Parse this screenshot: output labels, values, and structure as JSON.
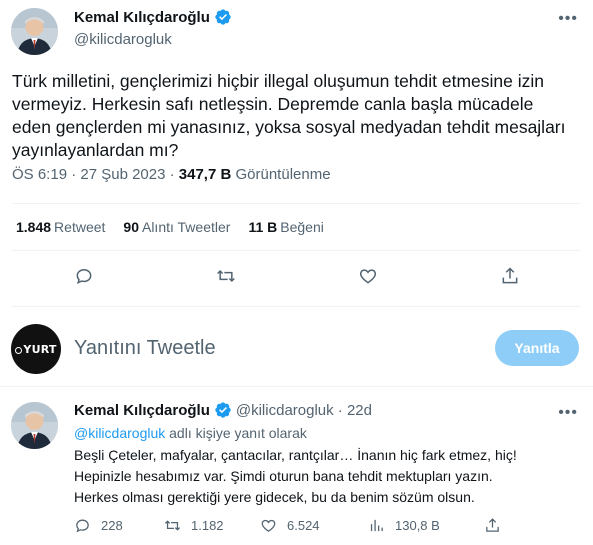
{
  "main": {
    "display_name": "Kemal Kılıçdaroğlu",
    "handle": "@kilicdarogluk",
    "text": "Türk milletini, gençlerimizi hiçbir illegal oluşumun tehdit etmesine izin vermeyiz. Herkesin safı netleşsin. Depremde canla başla mücadele eden gençlerden mi yanasınız, yoksa sosyal medyadan tehdit mesajları yayınlayanlardan mı?",
    "time": "ÖS 6:19 · 27 Şub 2023 · ",
    "views": "347,7 B",
    "views_label": " Görüntülenme",
    "stats": {
      "retweets": "1.848",
      "retweets_label": "Retweet",
      "quotes": "90",
      "quotes_label": "Alıntı Tweetler",
      "likes": "11 B",
      "likes_label": "Beğeni"
    }
  },
  "reply_box": {
    "avatar_text": "YURT",
    "prompt": "Yanıtını Tweetle",
    "button": "Yanıtla"
  },
  "reply": {
    "display_name": "Kemal Kılıçdaroğlu",
    "handle_time": "@kilicdarogluk · 22d",
    "replying_link": "@kilicdarogluk",
    "replying_rest": " adlı kişiye yanıt olarak",
    "lines": [
      "Beşli Çeteler, mafyalar, çantacılar, rantçılar… İnanın hiç fark etmez, hiç!",
      "Hepinizle hesabımız var. Şimdi oturun bana tehdit mektupları yazın.",
      "Herkes olması gerektiği yere gidecek, bu da benim sözüm olsun."
    ],
    "counts": {
      "replies": "228",
      "retweets": "1.182",
      "likes": "6.524",
      "views": "130,8 B"
    }
  },
  "colors": {
    "accent": "#1d9bf0",
    "muted": "#536471",
    "reply_button": "#8ecdf8"
  }
}
